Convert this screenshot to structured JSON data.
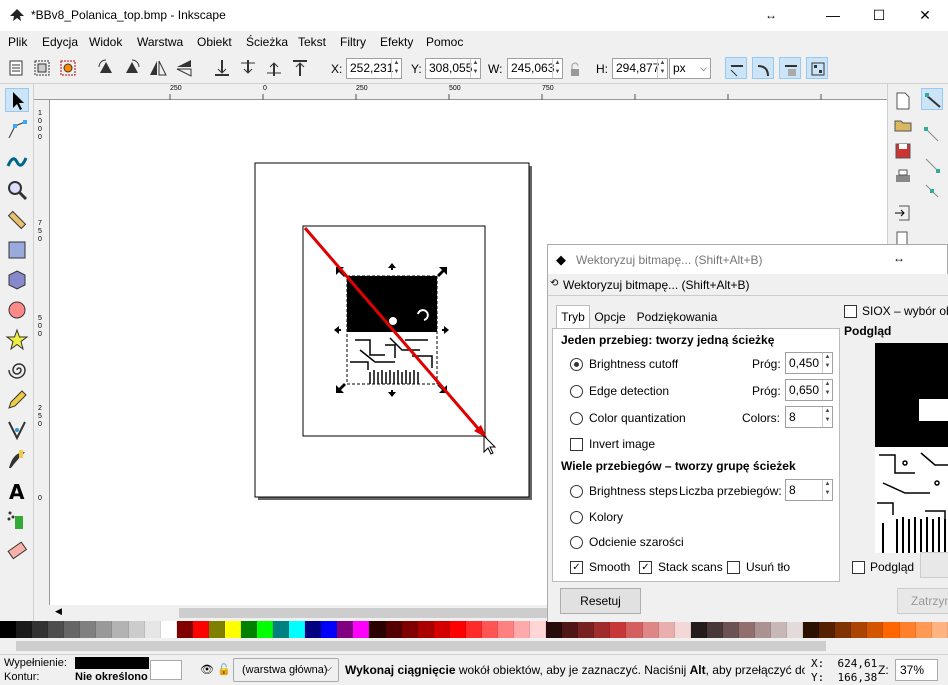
{
  "window": {
    "title": "*BBv8_Polanica_top.bmp - Inkscape"
  },
  "menu": [
    "Plik",
    "Edycja",
    "Widok",
    "Warstwa",
    "Obiekt",
    "Ścieżka",
    "Tekst",
    "Filtry",
    "Efekty",
    "Pomoc"
  ],
  "toolbar": {
    "x_label": "X:",
    "x_value": "252,231",
    "y_label": "Y:",
    "y_value": "308,055",
    "w_label": "W:",
    "w_value": "245,063",
    "h_label": "H:",
    "h_value": "294,877",
    "unit": "px"
  },
  "ruler_top": [
    "250",
    "0",
    "250",
    "500",
    "750"
  ],
  "dialog": {
    "window_title": "Wektoryzuj bitmapę... (Shift+Alt+B)",
    "header": "Wektoryzuj bitmapę... (Shift+Alt+B)",
    "tabs": [
      "Tryb",
      "Opcje",
      "Podziękowania"
    ],
    "single_scan_heading": "Jeden przebieg: tworzy jedną ścieżkę",
    "brightness_cutoff": "Brightness cutoff",
    "edge_detection": "Edge detection",
    "color_quantization": "Color quantization",
    "invert_image": "Invert image",
    "threshold_label": "Próg:",
    "threshold_1": "0,450",
    "threshold_2": "0,650",
    "colors_label": "Colors:",
    "colors_value": "8",
    "multi_scan_heading": "Wiele przebiegów – tworzy grupę ścieżek",
    "brightness_steps": "Brightness steps",
    "scans_label": "Liczba przebiegów:",
    "scans_value": "8",
    "kolory": "Kolory",
    "grayscale": "Odcienie szarości",
    "smooth": "Smooth",
    "stack_scans": "Stack scans",
    "remove_bg": "Usuń tło",
    "reset_button": "Resetuj",
    "siox": "SIOX – wybór ob",
    "preview_heading": "Podgląd",
    "preview_check": "Podgląd",
    "stop_button": "Zatrzym"
  },
  "status": {
    "fill_label": "Wypełnienie:",
    "stroke_label": "Kontur:",
    "stroke_value": "Nie określono",
    "layer": "(warstwa główna)",
    "message_bold1": "Wykonaj ciągnięcie",
    "message_mid": " wokół obiektów, aby je zaznaczyć. Naciśnij ",
    "message_bold2": "Alt",
    "message_end": ", aby przełączyć do...",
    "coord_x": "X:  624,61",
    "coord_y": "Y:  166,38",
    "zoom_label": "Z:",
    "zoom_value": "37%"
  },
  "colors": {
    "accent_red": "#e00000",
    "selected_toolbtn": "#cce4f7"
  }
}
